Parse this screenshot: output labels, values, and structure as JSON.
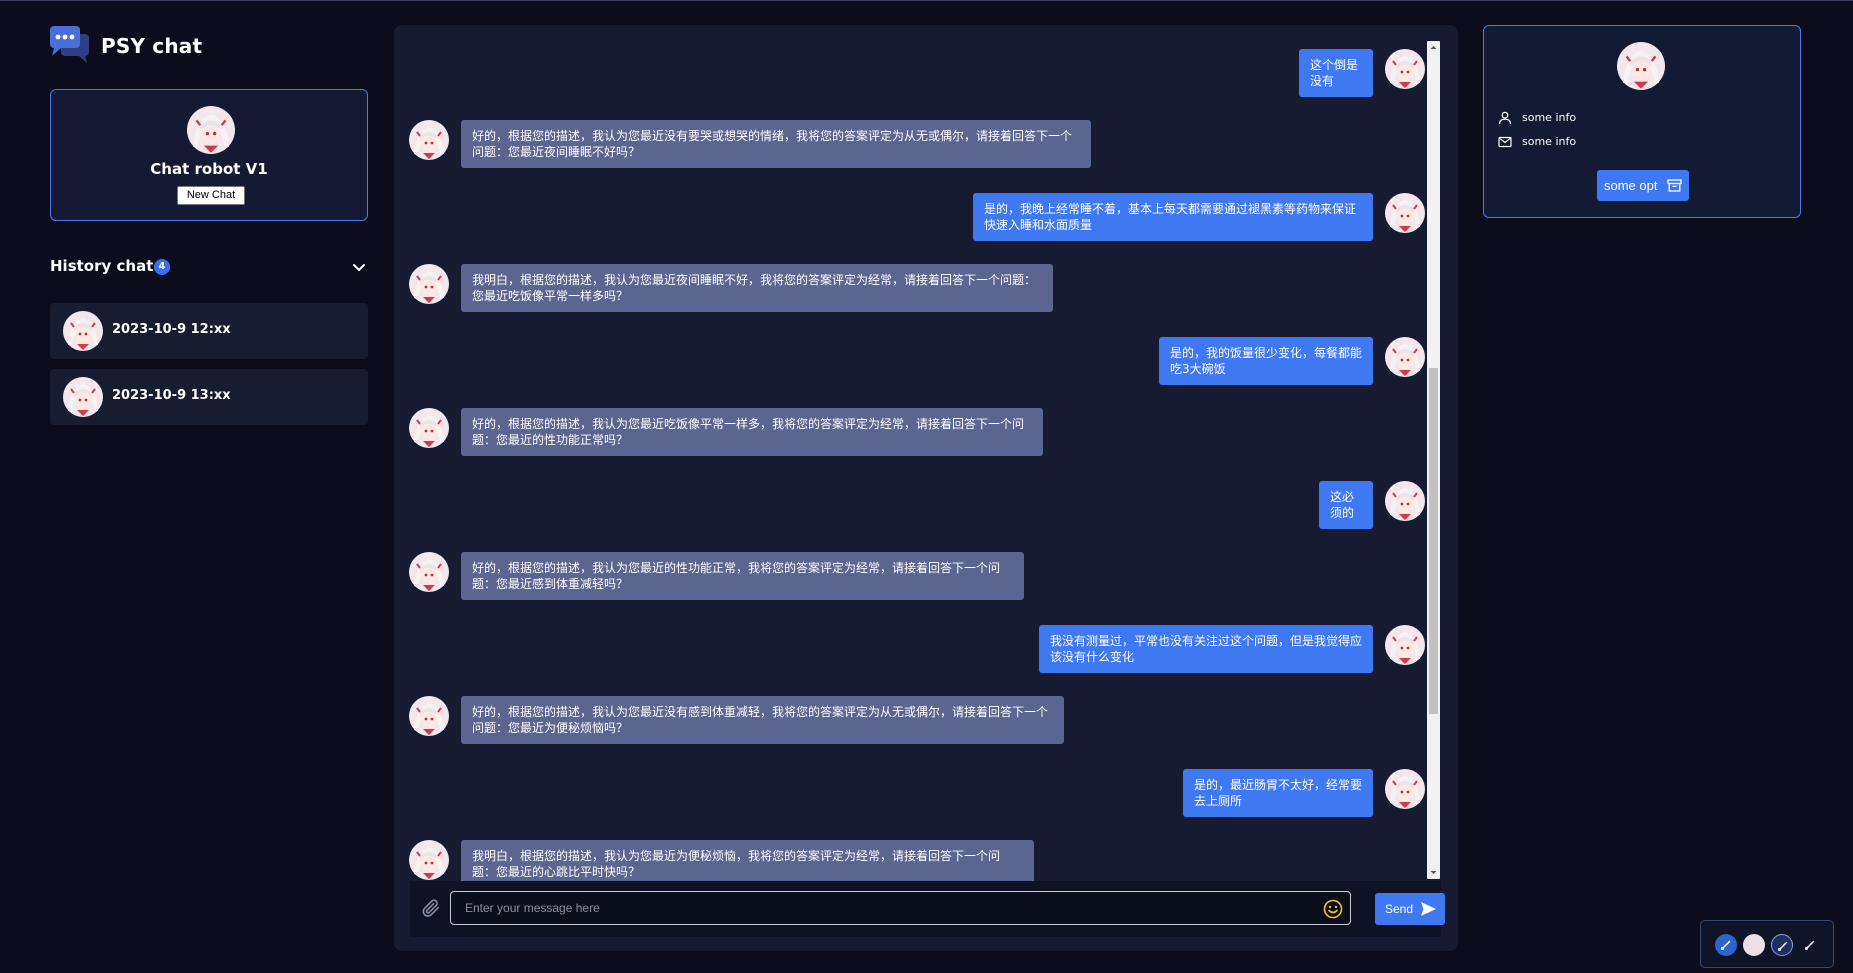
{
  "app": {
    "title": "PSY chat"
  },
  "bot": {
    "name": "Chat robot V1",
    "new_chat_label": "New Chat"
  },
  "history": {
    "title": "History chat",
    "count": "4",
    "items": [
      {
        "label": "2023-10-9 12:xx"
      },
      {
        "label": "2023-10-9 13:xx"
      }
    ]
  },
  "messages": [
    {
      "role": "user",
      "text": "这个倒是没有"
    },
    {
      "role": "bot",
      "text": "好的，根据您的描述，我认为您最近没有要哭或想哭的情绪，我将您的答案评定为从无或偶尔，请接着回答下一个问题：您最近夜间睡眠不好吗？"
    },
    {
      "role": "user",
      "text": "是的，我晚上经常睡不着，基本上每天都需要通过褪黑素等药物来保证快速入睡和水面质量"
    },
    {
      "role": "bot",
      "text": "我明白，根据您的描述，我认为您最近夜间睡眠不好，我将您的答案评定为经常，请接着回答下一个问题：您最近吃饭像平常一样多吗？"
    },
    {
      "role": "user",
      "text": "是的，我的饭量很少变化，每餐都能吃3大碗饭"
    },
    {
      "role": "bot",
      "text": "好的，根据您的描述，我认为您最近吃饭像平常一样多，我将您的答案评定为经常，请接着回答下一个问题：您最近的性功能正常吗？"
    },
    {
      "role": "user",
      "text": "这必须的"
    },
    {
      "role": "bot",
      "text": "好的，根据您的描述，我认为您最近的性功能正常，我将您的答案评定为经常，请接着回答下一个问题：您最近感到体重减轻吗？"
    },
    {
      "role": "user",
      "text": "我没有测量过，平常也没有关注过这个问题，但是我觉得应该没有什么变化"
    },
    {
      "role": "bot",
      "text": "好的，根据您的描述，我认为您最近没有感到体重减轻，我将您的答案评定为从无或偶尔，请接着回答下一个问题：您最近为便秘烦恼吗？"
    },
    {
      "role": "user",
      "text": "是的，最近肠胃不太好，经常要去上厕所"
    },
    {
      "role": "bot",
      "text": "我明白，根据您的描述，我认为您最近为便秘烦恼，我将您的答案评定为经常，请接着回答下一个问题：您最近的心跳比平时快吗？"
    }
  ],
  "composer": {
    "placeholder": "Enter your message here",
    "send_label": "Send"
  },
  "profile": {
    "info": [
      {
        "icon": "user-icon",
        "text": "some info"
      },
      {
        "icon": "mail-icon",
        "text": "some info"
      }
    ],
    "option_label": "some opt"
  },
  "theme": {
    "accent": "#3f79f2",
    "bot_bubble": "#5b6690",
    "panel": "#161b31",
    "background": "#0c0c1c"
  }
}
